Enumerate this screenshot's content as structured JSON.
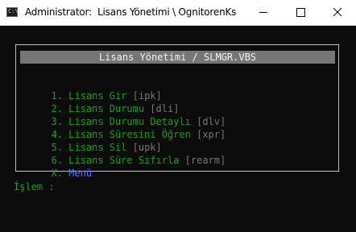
{
  "window": {
    "icon_text": "C:\\",
    "title": "Administrator:  Lisans Yönetimi \\ OgnitorenKs",
    "controls": [
      "minimize-icon",
      "maximize-icon",
      "close-icon"
    ]
  },
  "console": {
    "header": "Lisans Yönetimi / SLMGR.VBS",
    "menu": [
      {
        "key": "1.",
        "label": "Lisans Gir",
        "code": "[ipk]"
      },
      {
        "key": "2.",
        "label": "Lisans Durumu",
        "code": "[dli]"
      },
      {
        "key": "3.",
        "label": "Lisans Durumu Detaylı",
        "code": "[dlv]"
      },
      {
        "key": "4.",
        "label": "Lisans Süresini Öğren",
        "code": "[xpr]"
      },
      {
        "key": "5.",
        "label": "Lisans Sil",
        "code": "[upk]"
      },
      {
        "key": "6.",
        "label": "Lisans Süre Sıfırla",
        "code": "[rearm]"
      },
      {
        "key": "X.",
        "label": "Menü",
        "code": ""
      }
    ],
    "prompt": "İşlem :"
  },
  "colors": {
    "background": "#0c0c0c",
    "green": "#13a10e",
    "gray": "#767676",
    "blue": "#3b78ff",
    "header_bg": "#767676",
    "header_text": "#f2f2f2"
  }
}
